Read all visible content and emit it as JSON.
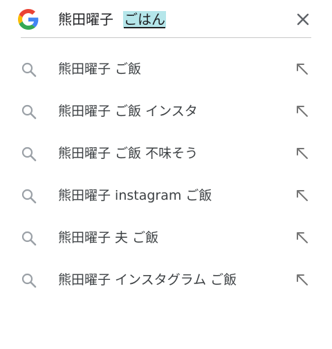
{
  "search": {
    "query_committed": "熊田曜子",
    "query_composing": "ごはん"
  },
  "icons": {
    "logo": "google-g-logo",
    "clear": "close-icon",
    "suggestion": "search-icon",
    "fill": "arrow-up-left-icon"
  },
  "colors": {
    "blue": "#4285F4",
    "red": "#EA4335",
    "yellow": "#FBBC05",
    "green": "#34A853",
    "composing_highlight": "#b5e6ea"
  },
  "suggestions": [
    {
      "text": "熊田曜子 ご飯"
    },
    {
      "text": "熊田曜子 ご飯 インスタ"
    },
    {
      "text": "熊田曜子 ご飯 不味そう"
    },
    {
      "text": "熊田曜子 instagram ご飯"
    },
    {
      "text": "熊田曜子 夫 ご飯"
    },
    {
      "text": "熊田曜子 インスタグラム ご飯"
    }
  ]
}
